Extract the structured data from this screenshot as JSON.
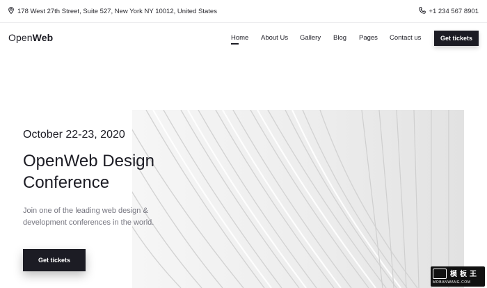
{
  "topbar": {
    "address": "178 West 27th Street, Suite 527, New York NY 10012, United States",
    "phone": "+1 234 567 8901",
    "address_icon": "map-pin-icon",
    "phone_icon": "phone-icon"
  },
  "header": {
    "logo_light": "Open",
    "logo_bold": "Web",
    "nav": [
      {
        "label": "Home",
        "active": true
      },
      {
        "label": "About Us"
      },
      {
        "label": "Gallery"
      },
      {
        "label": "Blog"
      },
      {
        "label": "Pages"
      },
      {
        "label": "Contact us"
      }
    ],
    "cta_label": "Get tickets"
  },
  "hero": {
    "date": "October 22-23, 2020",
    "title": "OpenWeb Design Conference",
    "description": "Join one of the leading web design & development conferences in the world.",
    "cta_label": "Get tickets"
  },
  "watermark": {
    "title": "模板王",
    "subtitle": "MOBANWANG.COM"
  },
  "colors": {
    "primary": "#1c1c24",
    "muted_text": "#767680",
    "background": "#ffffff",
    "hero_image_bg": "#efefef"
  }
}
